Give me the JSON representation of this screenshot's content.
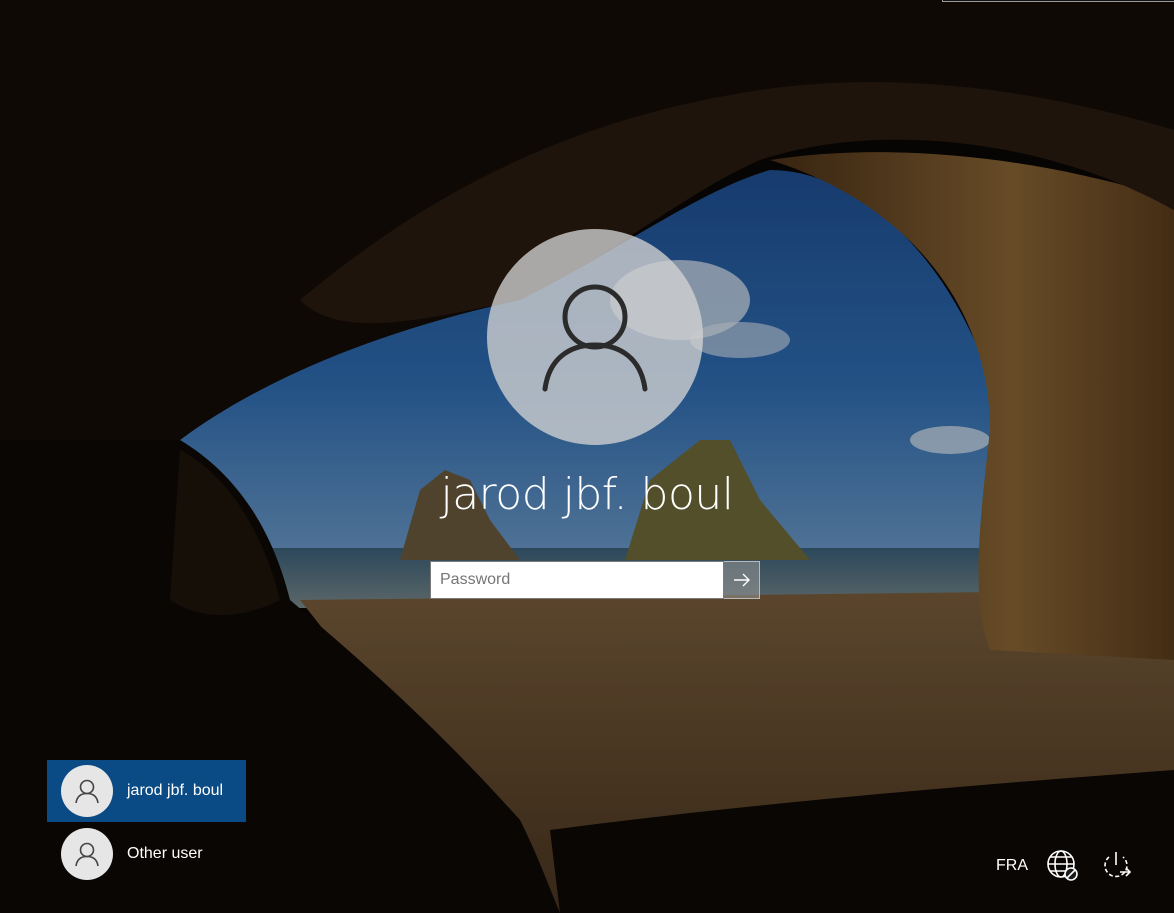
{
  "user": {
    "name": "jarod jbf. boul"
  },
  "password": {
    "placeholder": "Password",
    "value": ""
  },
  "user_list": [
    {
      "label": "jarod jbf. boul",
      "selected": true
    },
    {
      "label": "Other user",
      "selected": false
    }
  ],
  "system_tray": {
    "language": "FRA",
    "icons": [
      "network-icon",
      "ease-of-access-icon"
    ]
  },
  "colors": {
    "selected_user_bg": "#0a4a85"
  }
}
